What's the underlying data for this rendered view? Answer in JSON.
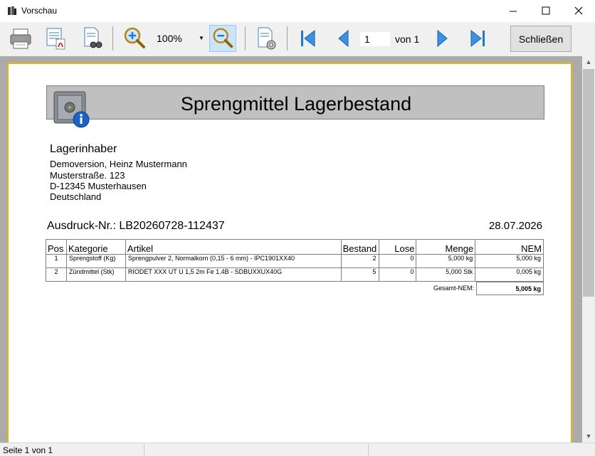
{
  "window": {
    "title": "Vorschau"
  },
  "toolbar": {
    "zoom_value": "100%",
    "page_current": "1",
    "page_of_label": "von 1",
    "close_label": "Schließen"
  },
  "report": {
    "title": "Sprengmittel Lagerbestand",
    "owner": {
      "heading": "Lagerinhaber",
      "name": "Demoversion, Heinz Mustermann",
      "street": "Musterstraße. 123",
      "city": "D-12345 Musterhausen",
      "country": "Deutschland"
    },
    "print_nr": "Ausdruck-Nr.: LB20260728-112437",
    "date": "28.07.2026",
    "columns": {
      "pos": "Pos",
      "category": "Kategorie",
      "article": "Artikel",
      "stock": "Bestand",
      "lots": "Lose",
      "quantity": "Menge",
      "nem": "NEM"
    },
    "rows": [
      {
        "pos": "1",
        "category": "Sprengstoff (Kg)",
        "article": "Sprengpulver 2, Normalkorn (0,15 - 6 mm) - IPC1901XX40",
        "stock": "2",
        "lots": "0",
        "quantity": "5,000 kg",
        "nem": "5,000 kg"
      },
      {
        "pos": "2",
        "category": "Zündmittel (Stk)",
        "article": "RIODET XXX UT U 1,5 2m Fe 1.4B - SDBUXXUX40G",
        "stock": "5",
        "lots": "0",
        "quantity": "5,000 Stk",
        "nem": "0,005 kg"
      }
    ],
    "total_label": "Gesamt-NEM:",
    "total_value": "5,005 kg"
  },
  "status": {
    "text": "Seite 1 von 1"
  },
  "colors": {
    "page_border": "#e8b800",
    "header_bg": "#c0c0c0",
    "viewport_bg": "#ababab",
    "accent": "#1e78d2"
  }
}
